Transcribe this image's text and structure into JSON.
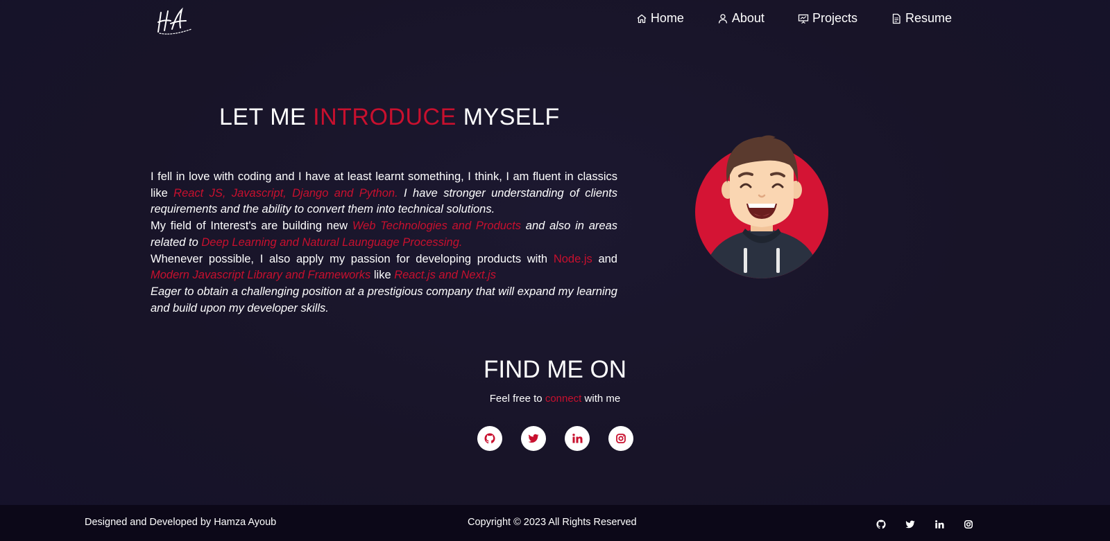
{
  "nav": {
    "brand_icon": "signature-logo",
    "items": [
      {
        "label": "Home",
        "icon": "home-icon"
      },
      {
        "label": "About",
        "icon": "user-icon"
      },
      {
        "label": "Projects",
        "icon": "presentation-icon"
      },
      {
        "label": "Resume",
        "icon": "document-icon"
      }
    ]
  },
  "about": {
    "heading": {
      "part1": "LET ME ",
      "accent": "INTRODUCE",
      "part2": " MYSELF"
    },
    "p1": {
      "t1": "I fell in love with coding and I have at least learnt something, I think, I am fluent in classics like ",
      "a1": "React JS, Javascript, Django and Python.",
      "t2": " I have stronger understanding of clients requirements and the ability to convert them into technical solutions."
    },
    "p2": {
      "t1": "My field of Interest's are building new ",
      "a1": "Web Technologies and Products",
      "t2": " and also in areas related to ",
      "a2": "Deep Learning and Natural Launguage Processing."
    },
    "p3": {
      "t1": "Whenever possible, I also apply my passion for developing products with ",
      "a1": "Node.js",
      "t2": " and ",
      "a2": "Modern Javascript Library and Frameworks",
      "t3": " like ",
      "a3": "React.js and Next.js"
    },
    "p4": "Eager to obtain a challenging position at a prestigious company that will expand my learning and build upon my developer skills.",
    "avatar_icon": "avatar-illustration"
  },
  "find": {
    "heading": "FIND ME ON",
    "sub_before": "Feel free to ",
    "sub_accent": "connect",
    "sub_after": " with me",
    "socials": [
      "github-icon",
      "twitter-icon",
      "linkedin-icon",
      "instagram-icon"
    ]
  },
  "footer": {
    "left": "Designed and Developed by Hamza Ayoub",
    "center": "Copyright © 2023 All Rights Reserved"
  },
  "colors": {
    "background": "#181428",
    "accent": "#c8102e",
    "footer": "#0c0818"
  }
}
